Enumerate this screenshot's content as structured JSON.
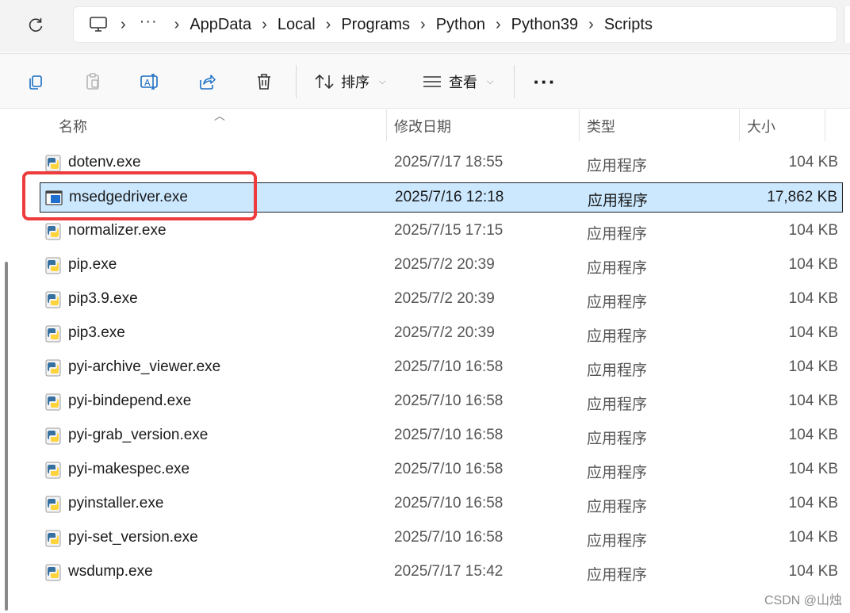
{
  "breadcrumb": {
    "more": "···",
    "items": [
      "AppData",
      "Local",
      "Programs",
      "Python",
      "Python39",
      "Scripts"
    ]
  },
  "toolbar": {
    "sort_label": "排序",
    "view_label": "查看",
    "more_label": "···"
  },
  "columns": {
    "name": "名称",
    "date": "修改日期",
    "type": "类型",
    "size": "大小"
  },
  "files": [
    {
      "name": "dotenv.exe",
      "date": "2025/7/17 18:55",
      "type": "应用程序",
      "size": "104 KB",
      "icon": "python-exe-icon"
    },
    {
      "name": "msedgedriver.exe",
      "date": "2025/7/16 12:18",
      "type": "应用程序",
      "size": "17,862 KB",
      "icon": "app-window-icon",
      "selected": true
    },
    {
      "name": "normalizer.exe",
      "date": "2025/7/15 17:15",
      "type": "应用程序",
      "size": "104 KB",
      "icon": "python-exe-icon"
    },
    {
      "name": "pip.exe",
      "date": "2025/7/2 20:39",
      "type": "应用程序",
      "size": "104 KB",
      "icon": "python-exe-icon"
    },
    {
      "name": "pip3.9.exe",
      "date": "2025/7/2 20:39",
      "type": "应用程序",
      "size": "104 KB",
      "icon": "python-exe-icon"
    },
    {
      "name": "pip3.exe",
      "date": "2025/7/2 20:39",
      "type": "应用程序",
      "size": "104 KB",
      "icon": "python-exe-icon"
    },
    {
      "name": "pyi-archive_viewer.exe",
      "date": "2025/7/10 16:58",
      "type": "应用程序",
      "size": "104 KB",
      "icon": "python-exe-icon"
    },
    {
      "name": "pyi-bindepend.exe",
      "date": "2025/7/10 16:58",
      "type": "应用程序",
      "size": "104 KB",
      "icon": "python-exe-icon"
    },
    {
      "name": "pyi-grab_version.exe",
      "date": "2025/7/10 16:58",
      "type": "应用程序",
      "size": "104 KB",
      "icon": "python-exe-icon"
    },
    {
      "name": "pyi-makespec.exe",
      "date": "2025/7/10 16:58",
      "type": "应用程序",
      "size": "104 KB",
      "icon": "python-exe-icon"
    },
    {
      "name": "pyinstaller.exe",
      "date": "2025/7/10 16:58",
      "type": "应用程序",
      "size": "104 KB",
      "icon": "python-exe-icon"
    },
    {
      "name": "pyi-set_version.exe",
      "date": "2025/7/10 16:58",
      "type": "应用程序",
      "size": "104 KB",
      "icon": "python-exe-icon"
    },
    {
      "name": "wsdump.exe",
      "date": "2025/7/17 15:42",
      "type": "应用程序",
      "size": "104 KB",
      "icon": "python-exe-icon"
    }
  ],
  "watermark": "CSDN @山烛",
  "colors": {
    "selection": "#cce8ff",
    "annotation": "#ee3b3b",
    "python_blue": "#3670a0",
    "python_yellow": "#ffd43b"
  }
}
